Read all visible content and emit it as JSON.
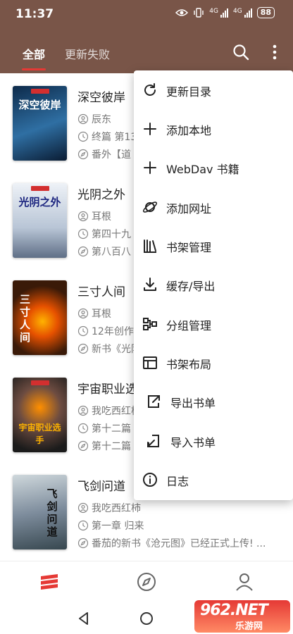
{
  "status": {
    "time": "11:37",
    "net1": "4G",
    "net2": "4G",
    "battery": "88"
  },
  "tabs": [
    {
      "label": "全部"
    },
    {
      "label": "更新失败"
    }
  ],
  "books": [
    {
      "title": "深空彼岸",
      "author": "辰东",
      "latest": "终篇 第13",
      "last_read": "番外【道",
      "cover_text": "深空彼岸",
      "cover_bg": "#1e3a5f",
      "cover_fg": "#ffffff"
    },
    {
      "title": "光阴之外",
      "author": "耳根",
      "latest": "第四十九",
      "last_read": "第八百八",
      "cover_text": "光阴之外",
      "cover_bg": "#dfe6ee",
      "cover_fg": "#1a237e"
    },
    {
      "title": "三寸人间",
      "author": "耳根",
      "latest": "12年创作",
      "last_read": "新书《光阴",
      "cover_text": "三寸人间",
      "cover_bg": "#3a1a08",
      "cover_fg": "#ffffff"
    },
    {
      "title": "宇宙职业选手",
      "author": "我吃西红柿",
      "latest": "第十二篇",
      "last_read": "第十二篇",
      "cover_text": "宇宙职业选手",
      "cover_bg": "#4e342e",
      "cover_fg": "#ffb300"
    },
    {
      "title": "飞剑问道",
      "author": "我吃西红柿",
      "latest": "第一章 归来",
      "last_read": "番茄的新书《沧元图》已经正式上传! ...",
      "cover_text": "飞剑问道",
      "cover_bg": "#7d8c9c",
      "cover_fg": "#111111"
    }
  ],
  "menu": [
    {
      "label": "更新目录",
      "icon": "refresh-icon"
    },
    {
      "label": "添加本地",
      "icon": "plus-icon"
    },
    {
      "label": "WebDav 书籍",
      "icon": "plus-icon"
    },
    {
      "label": "添加网址",
      "icon": "planet-icon"
    },
    {
      "label": "书架管理",
      "icon": "bookshelf-icon"
    },
    {
      "label": "缓存/导出",
      "icon": "download-icon"
    },
    {
      "label": "分组管理",
      "icon": "group-icon"
    },
    {
      "label": "书架布局",
      "icon": "layout-icon"
    },
    {
      "label": "导出书单",
      "icon": "export-icon"
    },
    {
      "label": "导入书单",
      "icon": "import-icon"
    },
    {
      "label": "日志",
      "icon": "info-icon"
    }
  ],
  "watermark": {
    "main": "962.NET",
    "sub": "乐游网"
  },
  "colors": {
    "header": "#795548",
    "accent": "#e53935"
  }
}
